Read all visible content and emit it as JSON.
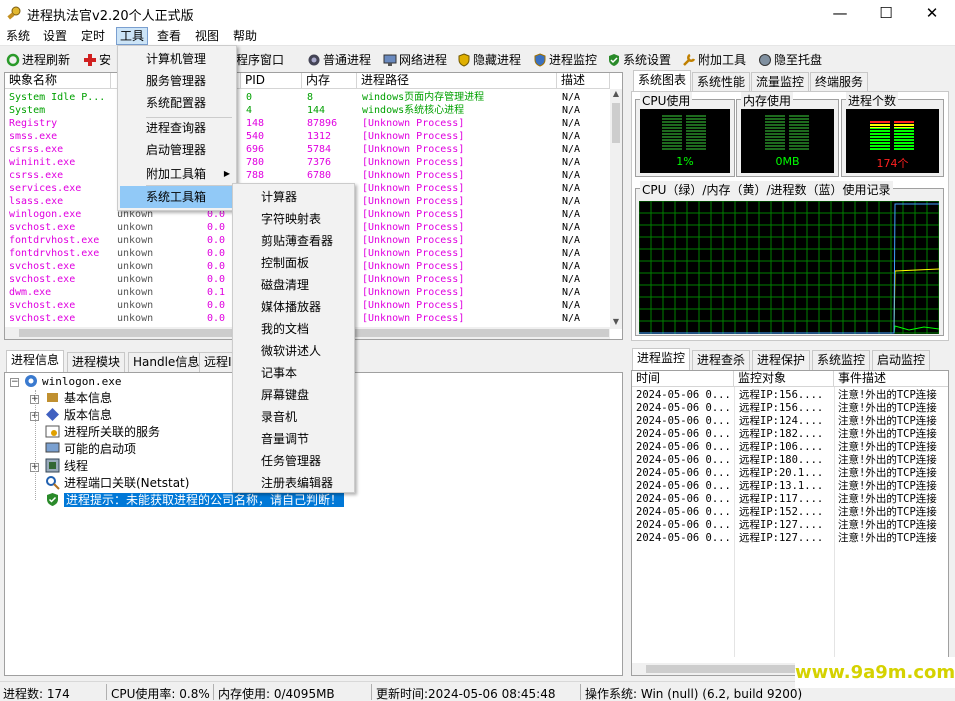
{
  "window": {
    "title": "进程执法官v2.20个人正式版"
  },
  "menubar": {
    "items": [
      "系统",
      "设置",
      "定时",
      "工具",
      "查看",
      "视图",
      "帮助"
    ]
  },
  "toolbar": {
    "buttons": [
      "进程刷新",
      "安",
      "程序窗口",
      "普通进程",
      "网络进程",
      "隐藏进程",
      "进程监控",
      "系统设置",
      "附加工具",
      "隐至托盘"
    ]
  },
  "process_list": {
    "columns": [
      "映象名称",
      "PID",
      "内存",
      "进程路径",
      "描述"
    ],
    "rows": [
      {
        "name": "System Idle P...",
        "col2": "",
        "col3": "",
        "pid": "0",
        "mem": "8",
        "path": "windows页面内存管理进程",
        "desc": "N/A",
        "color": "#00a000"
      },
      {
        "name": "System",
        "col2": "",
        "col3": "",
        "pid": "4",
        "mem": "144",
        "path": "windows系统核心进程",
        "desc": "N/A",
        "color": "#00a000"
      },
      {
        "name": "Registry",
        "col2": "",
        "col3": "",
        "pid": "148",
        "mem": "87896",
        "path": "[Unknown Process]",
        "desc": "N/A",
        "color": "#e000e0"
      },
      {
        "name": "smss.exe",
        "col2": "",
        "col3": "",
        "pid": "540",
        "mem": "1312",
        "path": "[Unknown Process]",
        "desc": "N/A",
        "color": "#e000e0"
      },
      {
        "name": "csrss.exe",
        "col2": "",
        "col3": "",
        "pid": "696",
        "mem": "5784",
        "path": "[Unknown Process]",
        "desc": "N/A",
        "color": "#e000e0"
      },
      {
        "name": "wininit.exe",
        "col2": "",
        "col3": "",
        "pid": "780",
        "mem": "7376",
        "path": "[Unknown Process]",
        "desc": "N/A",
        "color": "#e000e0"
      },
      {
        "name": "csrss.exe",
        "col2": "",
        "col3": "",
        "pid": "788",
        "mem": "6780",
        "path": "[Unknown Process]",
        "desc": "N/A",
        "color": "#e000e0"
      },
      {
        "name": "services.exe",
        "col2": "",
        "col3": "",
        "pid": "",
        "mem": "",
        "path": "[Unknown Process]",
        "desc": "N/A",
        "color": "#e000e0"
      },
      {
        "name": "lsass.exe",
        "col2": "",
        "col3": "",
        "pid": "",
        "mem": "",
        "path": "[Unknown Process]",
        "desc": "N/A",
        "color": "#e000e0"
      },
      {
        "name": "winlogon.exe",
        "col2": "unkown",
        "col3": "0.0",
        "pid": "",
        "mem": "",
        "path": "[Unknown Process]",
        "desc": "N/A",
        "color": "#e000e0"
      },
      {
        "name": "svchost.exe",
        "col2": "unkown",
        "col3": "0.0",
        "pid": "",
        "mem": "",
        "path": "[Unknown Process]",
        "desc": "N/A",
        "color": "#e000e0"
      },
      {
        "name": "fontdrvhost.exe",
        "col2": "unkown",
        "col3": "0.0",
        "pid": "",
        "mem": "",
        "path": "[Unknown Process]",
        "desc": "N/A",
        "color": "#e000e0"
      },
      {
        "name": "fontdrvhost.exe",
        "col2": "unkown",
        "col3": "0.0",
        "pid": "",
        "mem": "",
        "path": "[Unknown Process]",
        "desc": "N/A",
        "color": "#e000e0"
      },
      {
        "name": "svchost.exe",
        "col2": "unkown",
        "col3": "0.0",
        "pid": "",
        "mem": "",
        "path": "[Unknown Process]",
        "desc": "N/A",
        "color": "#e000e0"
      },
      {
        "name": "svchost.exe",
        "col2": "unkown",
        "col3": "0.0",
        "pid": "",
        "mem": "",
        "path": "[Unknown Process]",
        "desc": "N/A",
        "color": "#e000e0"
      },
      {
        "name": "dwm.exe",
        "col2": "unkown",
        "col3": "0.1",
        "pid": "",
        "mem": "",
        "path": "[Unknown Process]",
        "desc": "N/A",
        "color": "#e000e0"
      },
      {
        "name": "svchost.exe",
        "col2": "unkown",
        "col3": "0.0",
        "pid": "",
        "mem": "",
        "path": "[Unknown Process]",
        "desc": "N/A",
        "color": "#e000e0"
      },
      {
        "name": "svchost.exe",
        "col2": "unkown",
        "col3": "0.0",
        "pid": "",
        "mem": "",
        "path": "[Unknown Process]",
        "desc": "N/A",
        "color": "#e000e0"
      }
    ]
  },
  "right_top_tabs": [
    "系统图表",
    "系统性能",
    "流量监控",
    "终端服务"
  ],
  "meters": {
    "cpu_title": "CPU使用",
    "cpu_value": "1%",
    "mem_title": "内存使用",
    "mem_value": "0MB",
    "proc_title": "进程个数",
    "proc_value": "174个",
    "history_title": "CPU（绿）/内存（黄）/进程数（蓝）使用记录"
  },
  "detail_tabs": [
    "进程信息",
    "进程模块",
    "Handle信息",
    "远程I"
  ],
  "tree": {
    "root": "winlogon.exe",
    "children": [
      "基本信息",
      "版本信息",
      "进程所关联的服务",
      "可能的启动项",
      "线程",
      "进程端口关联(Netstat)",
      "进程提示：未能获取进程的公司名称，请自己判断！"
    ]
  },
  "monitor_tabs": [
    "进程监控",
    "进程查杀",
    "进程保护",
    "系统监控",
    "启动监控"
  ],
  "log": {
    "columns": [
      "时间",
      "监控对象",
      "事件描述"
    ],
    "rows": [
      [
        "2024-05-06 0...",
        "远程IP:156....",
        "注意!外出的TCP连接"
      ],
      [
        "2024-05-06 0...",
        "远程IP:156....",
        "注意!外出的TCP连接"
      ],
      [
        "2024-05-06 0...",
        "远程IP:124....",
        "注意!外出的TCP连接"
      ],
      [
        "2024-05-06 0...",
        "远程IP:182....",
        "注意!外出的TCP连接"
      ],
      [
        "2024-05-06 0...",
        "远程IP:106....",
        "注意!外出的TCP连接"
      ],
      [
        "2024-05-06 0...",
        "远程IP:180....",
        "注意!外出的TCP连接"
      ],
      [
        "2024-05-06 0...",
        "远程IP:20.1...",
        "注意!外出的TCP连接"
      ],
      [
        "2024-05-06 0...",
        "远程IP:13.1...",
        "注意!外出的TCP连接"
      ],
      [
        "2024-05-06 0...",
        "远程IP:117....",
        "注意!外出的TCP连接"
      ],
      [
        "2024-05-06 0...",
        "远程IP:152....",
        "注意!外出的TCP连接"
      ],
      [
        "2024-05-06 0...",
        "远程IP:127....",
        "注意!外出的TCP连接"
      ],
      [
        "2024-05-06 0...",
        "远程IP:127....",
        "注意!外出的TCP连接"
      ]
    ]
  },
  "tools_menu": {
    "items": [
      "计算机管理",
      "服务管理器",
      "系统配置器",
      "进程查询器",
      "启动管理器",
      "附加工具箱",
      "系统工具箱"
    ]
  },
  "system_tools_menu": {
    "items": [
      "计算器",
      "字符映射表",
      "剪贴薄查看器",
      "控制面板",
      "磁盘清理",
      "媒体播放器",
      "我的文档",
      "微软讲述人",
      "记事本",
      "屏幕键盘",
      "录音机",
      "音量调节",
      "任务管理器",
      "注册表编辑器"
    ]
  },
  "statusbar": {
    "proc_count": "进程数: 174",
    "cpu": "CPU使用率: 0.8%",
    "mem": "内存使用: 0/4095MB",
    "update": "更新时间:2024-05-06 08:45:48",
    "os": "操作系统: Win (null) (6.2, build 9200)"
  },
  "watermark": "www.9a9m.com",
  "colors": {
    "system_green": "#00a000",
    "unknown_magenta": "#e000e0",
    "meter_green": "#00ff00",
    "meter_red": "#ff0000",
    "grid_green": "#008000",
    "highlight": "#91c9f7"
  }
}
